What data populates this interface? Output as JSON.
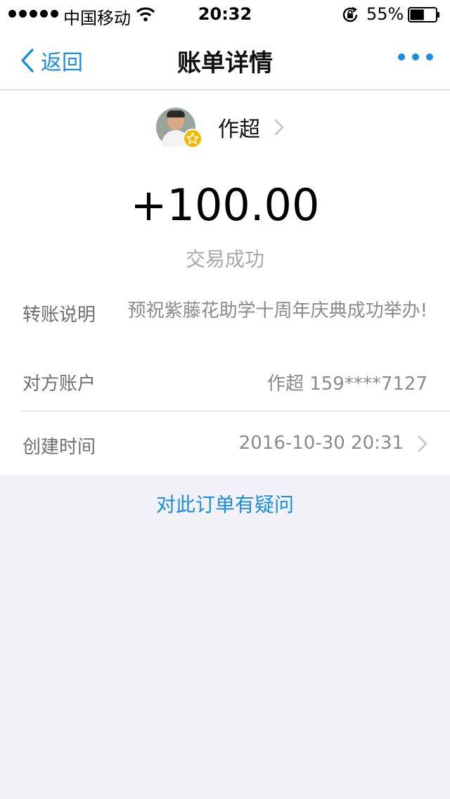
{
  "status_bar": {
    "carrier": "中国移动",
    "time": "20:32",
    "battery": "55%",
    "battery_level": 0.55
  },
  "nav": {
    "back_label": "返回",
    "title": "账单详情",
    "more_icon": "more-dots-icon"
  },
  "bill": {
    "payee_name": "作超",
    "amount": "+100.00",
    "status": "交易成功",
    "note_label": "转账说明",
    "note_value": "预祝紫藤花助学十周年庆典成功举办!",
    "account_label": "对方账户",
    "account_value": "作超 159****7127",
    "time_label": "创建时间",
    "time_value": "2016-10-30 20:31"
  },
  "query_link": "对此订单有疑问",
  "colors": {
    "accent": "#1a8fe0",
    "background": "#f2f1f7",
    "badge": "#f5b800"
  }
}
